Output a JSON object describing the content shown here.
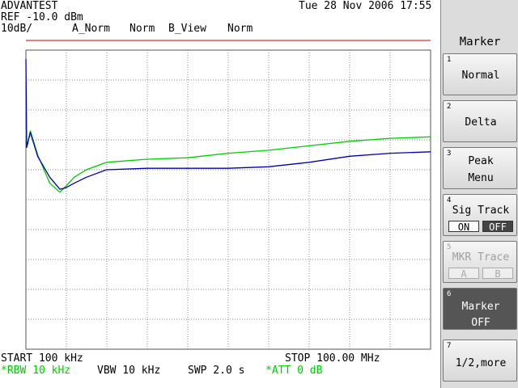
{
  "header": {
    "brand": "ADVANTEST",
    "datetime": "Tue 28 Nov 2006 17:55",
    "ref_level": "REF -10.0 dBm",
    "scale": "10dB/",
    "trace_a": "A_Norm",
    "trace_a_mode": "Norm",
    "trace_b": "B_View",
    "trace_b_mode": "Norm"
  },
  "footer": {
    "start": "START 100 kHz",
    "stop": "STOP 100.00 MHz",
    "rbw": "*RBW 10 kHz",
    "vbw": "VBW 10 kHz",
    "swp": "SWP 2.0 s",
    "att": "*ATT 0 dB"
  },
  "softkeys": {
    "title": "Marker",
    "keys": [
      {
        "num": "1",
        "line1": "Normal",
        "line2": ""
      },
      {
        "num": "2",
        "line1": "Delta",
        "line2": ""
      },
      {
        "num": "3",
        "line1": "Peak",
        "line2": "Menu"
      },
      {
        "num": "4",
        "line1": "Sig Track",
        "on": "ON",
        "off": "OFF"
      },
      {
        "num": "5",
        "line1": "MKR Trace",
        "on": "A",
        "off": "B"
      },
      {
        "num": "6",
        "line1": "Marker",
        "line2": "OFF"
      },
      {
        "num": "7",
        "line1": "1/2,more",
        "line2": ""
      }
    ]
  },
  "colors": {
    "trace_a": "#00cc00",
    "trace_b": "#0000aa",
    "ref_line": "#cc0000",
    "grid": "#888888",
    "accent_green": "#00cc00"
  },
  "chart_data": {
    "type": "line",
    "x_units": "Hz",
    "xlim": [
      100000,
      100000000
    ],
    "y_units": "dBm",
    "ylim": [
      -110,
      -10
    ],
    "ref_level": -10,
    "grid": true,
    "series": [
      {
        "name": "A_Norm",
        "x": [
          100000,
          300000,
          1200000,
          3000000,
          6000000,
          8500000,
          10000000,
          12000000,
          15000000,
          20000000,
          30000000,
          40000000,
          50000000,
          60000000,
          70000000,
          80000000,
          90000000,
          100000000
        ],
        "y": [
          -36,
          -42.5,
          -37,
          -45,
          -54.5,
          -57.5,
          -55.5,
          -52.5,
          -50,
          -47.5,
          -46.5,
          -46,
          -44.5,
          -43.5,
          -42,
          -40.5,
          -39.5,
          -39
        ]
      },
      {
        "name": "B_View",
        "x": [
          100000,
          300000,
          1200000,
          3000000,
          6000000,
          8500000,
          10000000,
          12000000,
          15000000,
          20000000,
          30000000,
          40000000,
          50000000,
          60000000,
          70000000,
          80000000,
          90000000,
          100000000
        ],
        "y": [
          -13,
          -42.5,
          -37.5,
          -45.5,
          -52.5,
          -56.5,
          -56,
          -54.5,
          -52.5,
          -50,
          -49.5,
          -49.5,
          -49.5,
          -49,
          -47.5,
          -45.5,
          -44.5,
          -44
        ]
      }
    ]
  }
}
